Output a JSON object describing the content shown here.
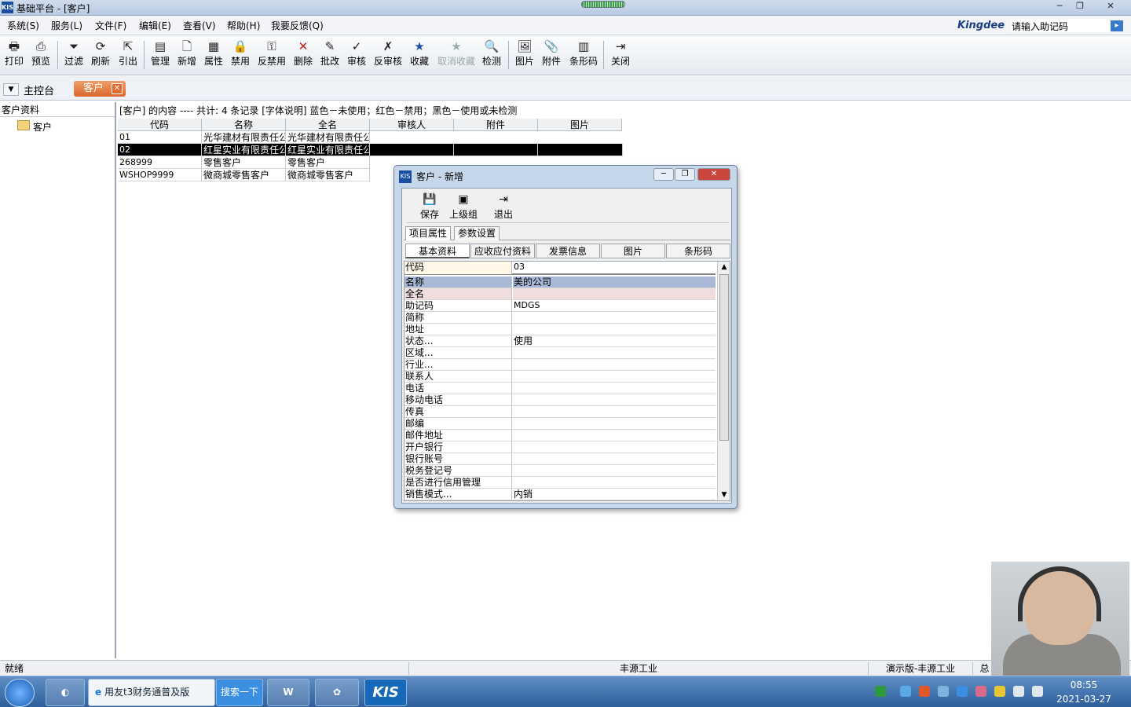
{
  "window": {
    "title": "基础平台 - [客户]",
    "logo": "KIS"
  },
  "menu": {
    "items": [
      "系统(S)",
      "服务(L)",
      "文件(F)",
      "编辑(E)",
      "查看(V)",
      "帮助(H)",
      "我要反馈(Q)"
    ],
    "brand": "Kingdee",
    "helpcode_placeholder": "请输入助记码"
  },
  "toolbar": {
    "buttons": [
      {
        "label": "打印",
        "icon": "printer-icon"
      },
      {
        "label": "预览",
        "icon": "preview-icon"
      },
      {
        "label": "过滤",
        "icon": "filter-icon"
      },
      {
        "label": "刷新",
        "icon": "refresh-icon"
      },
      {
        "label": "引出",
        "icon": "export-icon"
      },
      {
        "label": "管理",
        "icon": "manage-icon"
      },
      {
        "label": "新增",
        "icon": "new-icon"
      },
      {
        "label": "属性",
        "icon": "properties-icon"
      },
      {
        "label": "禁用",
        "icon": "disable-icon"
      },
      {
        "label": "反禁用",
        "icon": "enable-icon"
      },
      {
        "label": "删除",
        "icon": "delete-icon"
      },
      {
        "label": "批改",
        "icon": "batch-edit-icon"
      },
      {
        "label": "审核",
        "icon": "check-icon"
      },
      {
        "label": "反审核",
        "icon": "uncheck-icon"
      },
      {
        "label": "收藏",
        "icon": "star-icon"
      },
      {
        "label": "取消收藏",
        "icon": "unstar-icon",
        "disabled": true
      },
      {
        "label": "检测",
        "icon": "detect-icon"
      },
      {
        "label": "图片",
        "icon": "picture-icon"
      },
      {
        "label": "附件",
        "icon": "attachment-icon"
      },
      {
        "label": "条形码",
        "icon": "barcode-icon"
      },
      {
        "label": "关闭",
        "icon": "close-door-icon"
      }
    ]
  },
  "tabs": {
    "main": "主控台",
    "active": "客户"
  },
  "tree": {
    "header": "客户资料",
    "root": "客户"
  },
  "list": {
    "info": "[客户] 的内容 ---- 共计: 4 条记录  [字体说明] 蓝色－未使用；红色－禁用；黑色－使用或未检测",
    "columns": [
      "代码",
      "名称",
      "全名",
      "审核人",
      "附件",
      "图片"
    ],
    "rows": [
      [
        "01",
        "光华建材有限责任公",
        "光华建材有限责任公",
        "",
        "",
        ""
      ],
      [
        "02",
        "红星实业有限责任公",
        "红星实业有限责任公",
        "",
        "",
        ""
      ],
      [
        "268999",
        "零售客户",
        "零售客户",
        "",
        "",
        ""
      ],
      [
        "WSHOP9999",
        "微商城零售客户",
        "微商城零售客户",
        "",
        "",
        ""
      ]
    ]
  },
  "dialog": {
    "title": "客户 - 新增",
    "logo": "KIS",
    "tools": [
      {
        "label": "保存",
        "icon": "save-icon"
      },
      {
        "label": "上级组",
        "icon": "parent-group-icon"
      },
      {
        "label": "退出",
        "icon": "exit-icon"
      }
    ],
    "prop_tabs": [
      "项目属性",
      "参数设置"
    ],
    "sub_tabs": [
      "基本资料",
      "应收应付资料",
      "发票信息",
      "图片",
      "条形码"
    ],
    "fields": [
      {
        "key": "代码",
        "value": "03"
      },
      {
        "key": "名称",
        "value": "美的公司"
      },
      {
        "key": "全名",
        "value": ""
      },
      {
        "key": "助记码",
        "value": "MDGS"
      },
      {
        "key": "简称",
        "value": ""
      },
      {
        "key": "地址",
        "value": ""
      },
      {
        "key": "状态...",
        "value": "使用"
      },
      {
        "key": "区域...",
        "value": ""
      },
      {
        "key": "行业...",
        "value": ""
      },
      {
        "key": "联系人",
        "value": ""
      },
      {
        "key": "电话",
        "value": ""
      },
      {
        "key": "移动电话",
        "value": ""
      },
      {
        "key": "传真",
        "value": ""
      },
      {
        "key": "邮编",
        "value": ""
      },
      {
        "key": "邮件地址",
        "value": ""
      },
      {
        "key": "开户银行",
        "value": ""
      },
      {
        "key": "银行账号",
        "value": ""
      },
      {
        "key": "税务登记号",
        "value": ""
      },
      {
        "key": "是否进行信用管理",
        "value": ""
      },
      {
        "key": "销售模式...",
        "value": "内销"
      }
    ]
  },
  "status": {
    "left": "就绪",
    "company": "丰源工业",
    "edition": "演示版-丰源工业",
    "extra": "总"
  },
  "taskbar": {
    "ie_app": "用友t3财务通普及版",
    "search": "搜索一下",
    "kis": "KIS",
    "time": "08:55",
    "date": "2021-03-27"
  },
  "colors": {
    "selected_row": "#000000",
    "active_tab": "#d9662d",
    "highlight_row": "#a9b8d6"
  }
}
